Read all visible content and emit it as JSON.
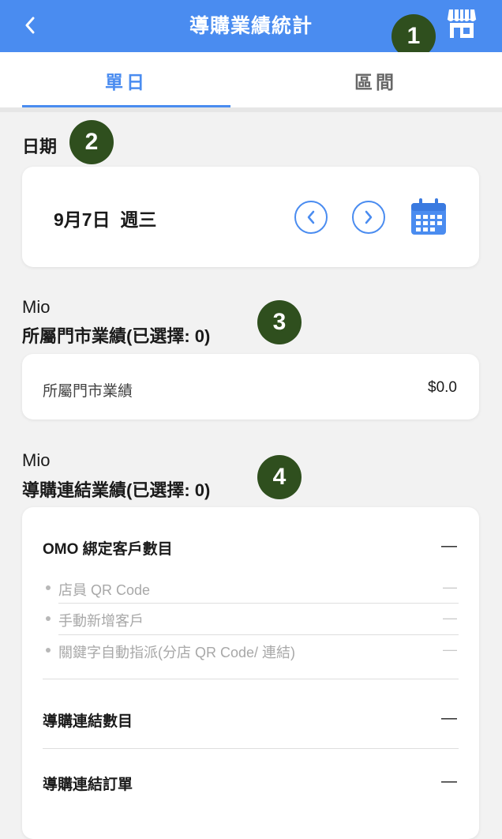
{
  "header": {
    "title": "導購業績統計",
    "back_icon": "chevron-left-icon",
    "store_icon": "storefront-icon",
    "accent": "#4a8cf0"
  },
  "tabs": [
    {
      "label": "單日",
      "active": true
    },
    {
      "label": "區間",
      "active": false
    }
  ],
  "markers": [
    "1",
    "2",
    "3",
    "4"
  ],
  "date_section": {
    "label": "日期",
    "date": "9月7日",
    "weekday": "週三"
  },
  "store_section": {
    "owner": "Mio",
    "title": "所屬門市業績(已選擇: 0)",
    "row_label": "所屬門市業績",
    "row_value": "$0.0"
  },
  "link_section": {
    "owner": "Mio",
    "title": "導購連結業績(已選擇: 0)",
    "omo": {
      "label": "OMO 綁定客戶數目",
      "value": "—",
      "items": [
        {
          "label": "店員 QR Code",
          "value": "—"
        },
        {
          "label": "手動新增客戶",
          "value": "—"
        },
        {
          "label": "關鍵字自動指派(分店 QR Code/ 連結)",
          "value": "—"
        }
      ]
    },
    "link_count": {
      "label": "導購連結數目",
      "value": "—"
    },
    "link_orders": {
      "label": "導購連結訂單",
      "value": "—"
    }
  }
}
